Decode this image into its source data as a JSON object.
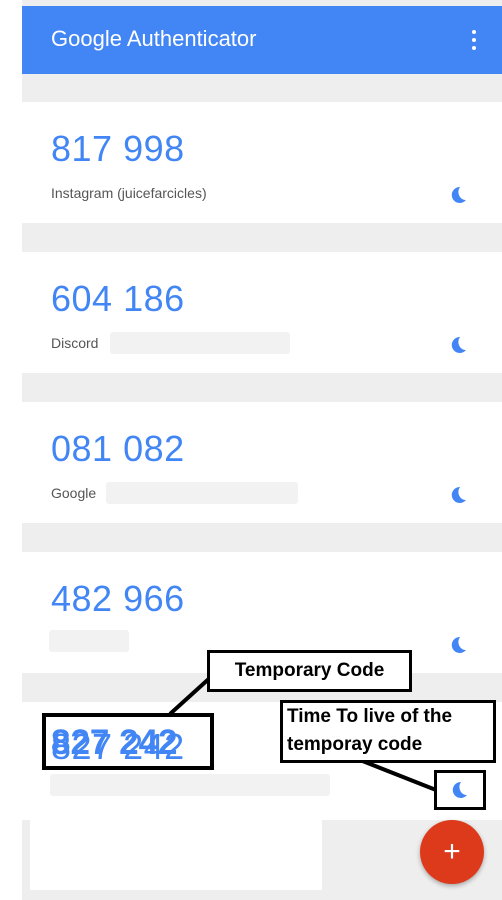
{
  "app": {
    "title": "Google Authenticator",
    "menu_icon": "more-vert-icon",
    "add_button_label": "+"
  },
  "colors": {
    "app_bar": "#4285f4",
    "code": "#4285f4",
    "fab": "#dd3a1c",
    "background": "#eeeeee"
  },
  "accounts": [
    {
      "code": "817 998",
      "label": "Instagram (juicefarcicles)",
      "timer_icon": "countdown-timer-icon"
    },
    {
      "code": "604 186",
      "label": "Discord",
      "timer_icon": "countdown-timer-icon"
    },
    {
      "code": "081 082",
      "label": "Google",
      "timer_icon": "countdown-timer-icon"
    },
    {
      "code": "482 966",
      "label": "",
      "timer_icon": "countdown-timer-icon"
    },
    {
      "code": "827 242",
      "label": "",
      "timer_icon": "countdown-timer-icon"
    }
  ],
  "annotations": {
    "temporary_code": "Temporary Code",
    "ttl_line1": "Time To live of the",
    "ttl_line2": "temporay code"
  }
}
